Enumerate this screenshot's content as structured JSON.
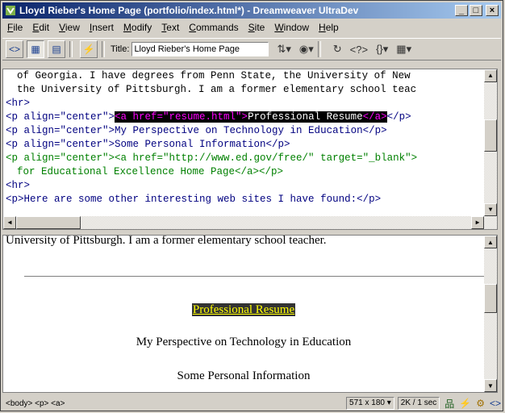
{
  "window": {
    "title": "Lloyd Rieber's Home Page (portfolio/index.html*) - Dreamweaver UltraDev",
    "controls": {
      "minimize": "_",
      "maximize": "□",
      "close": "×"
    }
  },
  "menu": [
    "File",
    "Edit",
    "View",
    "Insert",
    "Modify",
    "Text",
    "Commands",
    "Site",
    "Window",
    "Help"
  ],
  "toolbar": {
    "title_label": "Title:",
    "title_value": "Lloyd Rieber's Home Page"
  },
  "code_view": {
    "line1": "of Georgia. I have degrees from Penn State, the University of New",
    "line2": "the University of Pittsburgh. I am a former elementary school teac",
    "line3": "<hr>",
    "line4_pre": "<p align=\"center\">",
    "line4_sel_open": "<a href=\"resume.html\">",
    "line4_sel_text": "Professional Resume",
    "line4_sel_close": "</a>",
    "line4_post": "</p>",
    "line5": "<p align=\"center\">My Perspective on Technology in Education</p>",
    "line6": "<p align=\"center\">Some Personal Information</p>",
    "line7": "<p align=\"center\"><a href=\"http://www.ed.gov/free/\" target=\"_blank\">",
    "line8": "for Educational Excellence Home Page</a></p>",
    "line9": "<hr>",
    "line10": "<p>Here are some other interesting web sites I have found:</p>"
  },
  "design_view": {
    "top_text": "University of Pittsburgh. I am a former elementary school teacher.",
    "link_text": "Professional Resume",
    "para1": "My Perspective on Technology in Education",
    "para2": "Some Personal Information"
  },
  "status_bar": {
    "tag_selector": "<body> <p> <a>",
    "window_size": "571 x 180 ▾",
    "download": "2K / 1 sec"
  }
}
